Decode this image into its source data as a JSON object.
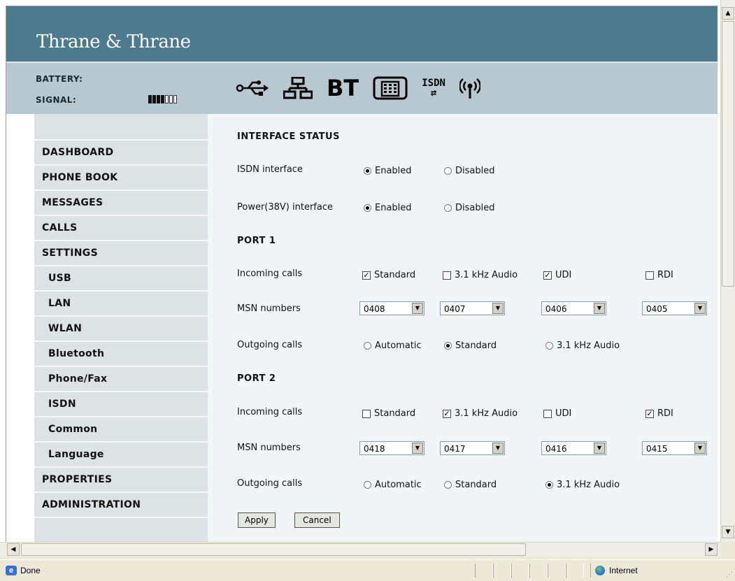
{
  "brand": "Thrane & Thrane",
  "status": {
    "battery_label": "BATTERY:",
    "signal_label": "SIGNAL:",
    "signal_level": 4,
    "signal_max": 7,
    "icons": [
      "usb-icon",
      "lan-icon",
      "bluetooth-icon",
      "phone-fax-icon",
      "isdn-icon",
      "wlan-icon"
    ],
    "bt_text": "BT",
    "isdn_text": "ISDN"
  },
  "sidebar": {
    "items": [
      {
        "label": "DASHBOARD",
        "sub": false
      },
      {
        "label": "PHONE BOOK",
        "sub": false
      },
      {
        "label": "MESSAGES",
        "sub": false
      },
      {
        "label": "CALLS",
        "sub": false
      },
      {
        "label": "SETTINGS",
        "sub": false
      },
      {
        "label": "USB",
        "sub": true
      },
      {
        "label": "LAN",
        "sub": true
      },
      {
        "label": "WLAN",
        "sub": true
      },
      {
        "label": "Bluetooth",
        "sub": true
      },
      {
        "label": "Phone/Fax",
        "sub": true
      },
      {
        "label": "ISDN",
        "sub": true
      },
      {
        "label": "Common",
        "sub": true
      },
      {
        "label": "Language",
        "sub": true
      },
      {
        "label": "PROPERTIES",
        "sub": false
      },
      {
        "label": "ADMINISTRATION",
        "sub": false
      }
    ]
  },
  "form": {
    "interface_status_title": "INTERFACE STATUS",
    "isdn_interface_label": "ISDN interface",
    "power_interface_label": "Power(38V) interface",
    "enabled_label": "Enabled",
    "disabled_label": "Disabled",
    "isdn_interface_value": "Enabled",
    "power_interface_value": "Enabled",
    "incoming_label": "Incoming calls",
    "msn_label": "MSN numbers",
    "outgoing_label": "Outgoing calls",
    "opt_standard": "Standard",
    "opt_audio": "3.1 kHz Audio",
    "opt_udi": "UDI",
    "opt_rdi": "RDI",
    "opt_automatic": "Automatic",
    "port1": {
      "title": "PORT 1",
      "incoming": {
        "standard": true,
        "audio": false,
        "udi": true,
        "rdi": false
      },
      "msn": [
        "0408",
        "0407",
        "0406",
        "0405"
      ],
      "outgoing": "Standard"
    },
    "port2": {
      "title": "PORT 2",
      "incoming": {
        "standard": false,
        "audio": true,
        "udi": false,
        "rdi": true
      },
      "msn": [
        "0418",
        "0417",
        "0416",
        "0415"
      ],
      "outgoing": "3.1 kHz Audio"
    },
    "apply_label": "Apply",
    "cancel_label": "Cancel"
  },
  "browser_status": {
    "left_text": "Done",
    "zone_text": "Internet"
  }
}
